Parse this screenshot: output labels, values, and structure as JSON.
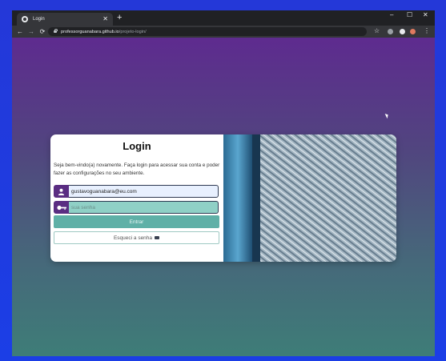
{
  "browser": {
    "tab_title": "Login",
    "tab_close": "✕",
    "new_tab": "+",
    "minimize": "–",
    "maximize": "☐",
    "close": "✕",
    "url_host": "professorguanabara.github.io",
    "url_path": "/projeto-login/"
  },
  "login": {
    "title": "Login",
    "welcome": "Seja bem-vindo(a) novamente. Faça login para acessar sua conta e poder fazer as configurações no seu ambiente.",
    "email_value": "gustavoguanabara@eu.com",
    "password_placeholder": "sua senha",
    "submit_label": "Entrar",
    "forgot_label": "Esqueci a senha"
  },
  "colors": {
    "accent": "#5a2d82",
    "button": "#5fb0a7"
  }
}
